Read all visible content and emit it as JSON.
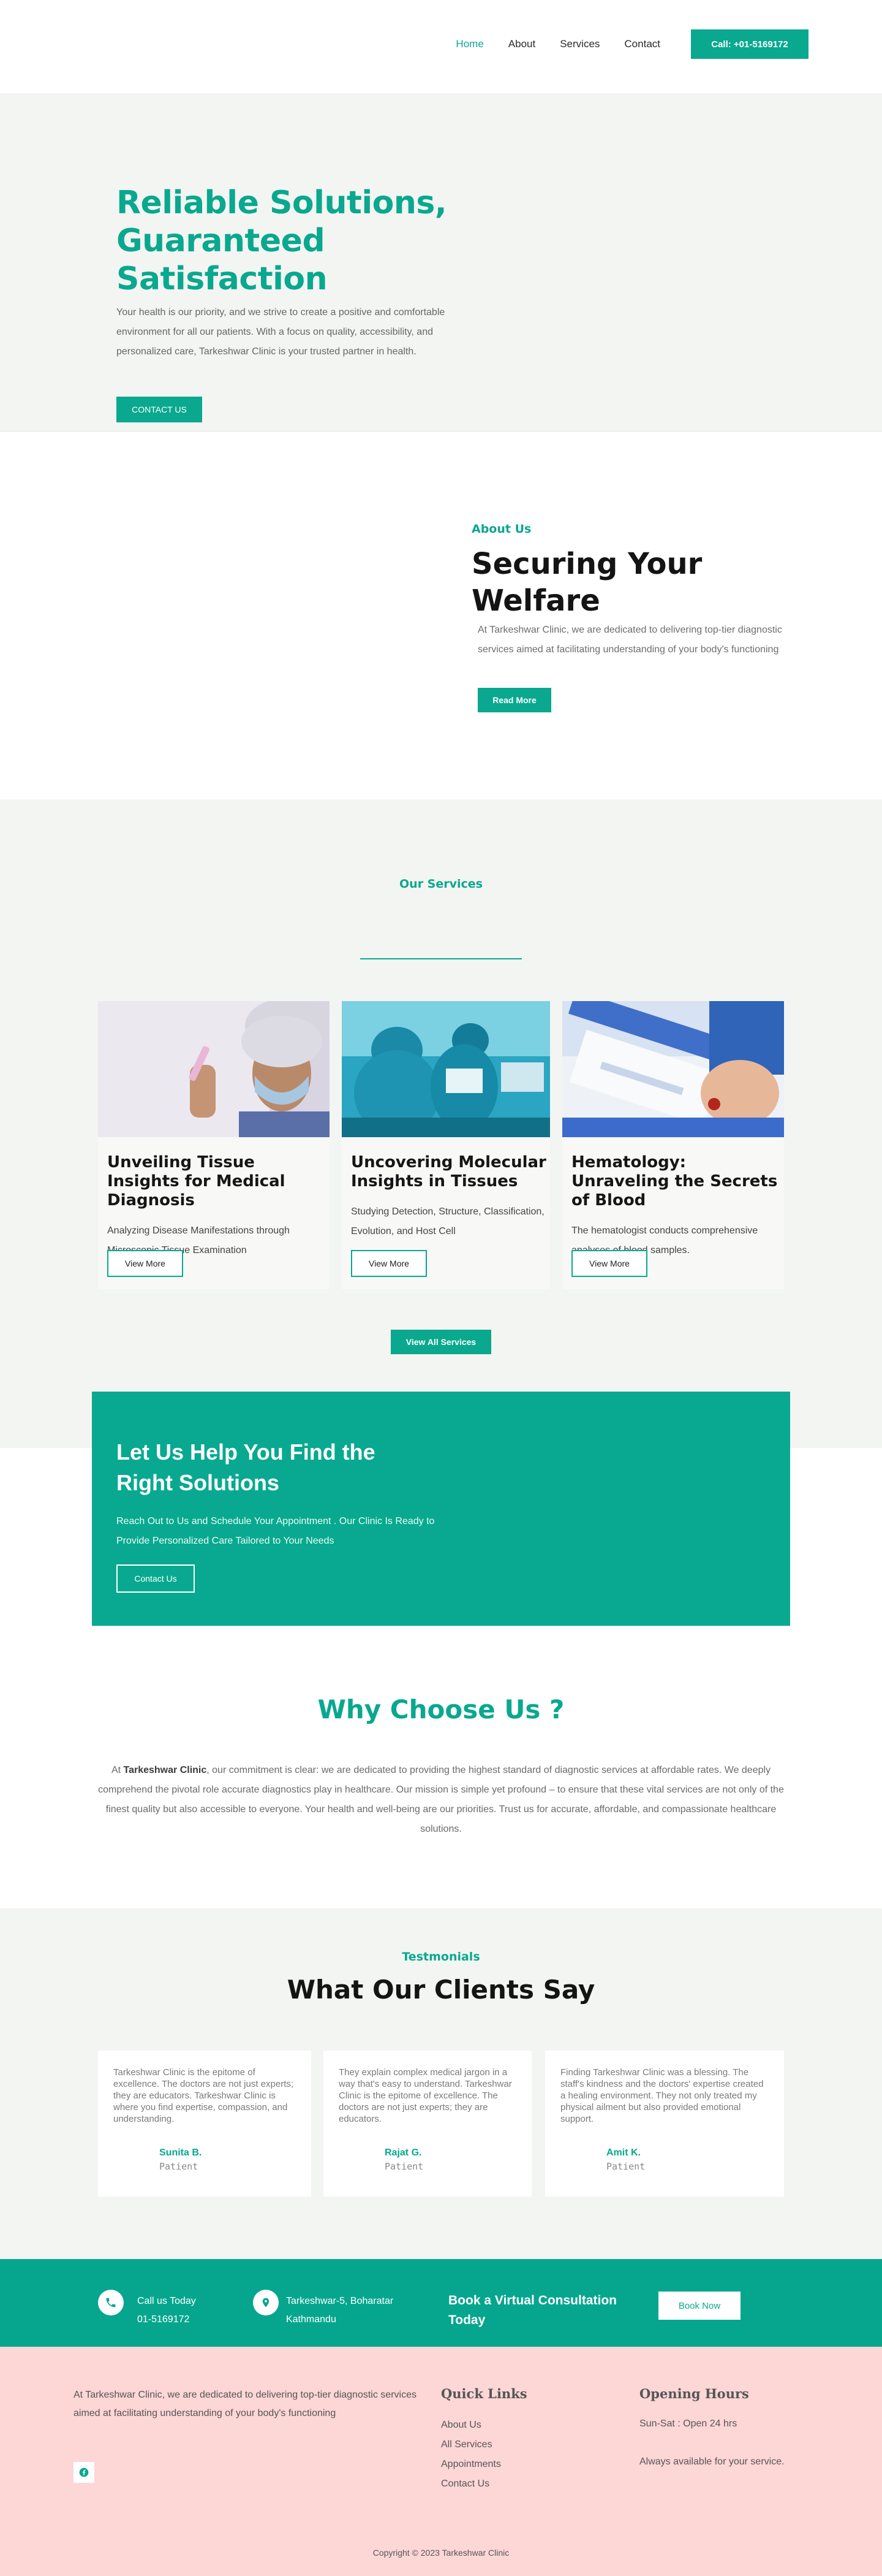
{
  "nav": {
    "items": [
      "Home",
      "About",
      "Services",
      "Contact"
    ],
    "call_label": "Call: +01-5169172"
  },
  "hero": {
    "title": "Reliable Solutions, Guaranteed Satisfaction",
    "text": "Your health is our priority, and we strive to create a positive and comfortable environment for all our patients. With a focus on quality, accessibility, and personalized care, Tarkeshwar Clinic is your trusted partner in health.",
    "button": "CONTACT US"
  },
  "about": {
    "eyebrow": "About Us",
    "title": "Securing Your Welfare",
    "text": "At Tarkeshwar Clinic, we are dedicated to delivering top-tier diagnostic services aimed at facilitating  understanding of your body's functioning",
    "button": "Read More"
  },
  "services": {
    "eyebrow": "Our Services",
    "cards": [
      {
        "title": "Unveiling Tissue Insights for Medical Diagnosis",
        "text": "Analyzing Disease Manifestations through Microscopic Tissue Examination",
        "button": "View More"
      },
      {
        "title": "Uncovering Molecular Insights in Tissues",
        "text": "Studying Detection, Structure, Classification, Evolution, and Host Cell",
        "button": "View More"
      },
      {
        "title": "Hematology: Unraveling the Secrets of Blood",
        "text": "The hematologist conducts comprehensive analyses of blood samples.",
        "button": "View More"
      }
    ],
    "all_button": "View All Services"
  },
  "cta": {
    "title": "Let Us Help You Find the Right Solutions",
    "text": "Reach Out to Us and Schedule Your Appointment . Our Clinic Is Ready to Provide Personalized Care Tailored to Your Needs",
    "button": "Contact Us"
  },
  "why": {
    "title": "Why Choose Us ?",
    "text_pre": "At ",
    "text_bold": "Tarkeshwar Clinic",
    "text_post": ", our commitment is clear: we are dedicated to providing the highest standard of diagnostic services at affordable rates. We deeply comprehend the pivotal role accurate diagnostics play in healthcare. Our mission is simple yet profound – to ensure that these vital services are not only of the finest quality but also accessible to everyone. Your health and well-being are our priorities. Trust us for accurate, affordable, and compassionate healthcare solutions."
  },
  "testimonials": {
    "eyebrow": "Testmonials",
    "title": "What Our Clients Say",
    "items": [
      {
        "text": "Tarkeshwar Clinic is the epitome of excellence. The doctors are not just experts; they are educators. Tarkeshwar Clinic is where you find expertise, compassion, and understanding.",
        "name": "Sunita B.",
        "role": "Patient"
      },
      {
        "text": "They explain complex medical jargon in a way that's easy to understand. Tarkeshwar Clinic is the epitome of excellence. The doctors are not just experts; they are educators.",
        "name": "Rajat G.",
        "role": "Patient"
      },
      {
        "text": "Finding Tarkeshwar Clinic was a blessing. The staff's kindness and the doctors' expertise created a healing environment. They not only treated my physical ailment but also provided emotional support.",
        "name": "Amit K.",
        "role": "Patient"
      }
    ]
  },
  "contact_strip": {
    "call_title": "Call us Today",
    "call_number": "01-5169172",
    "address_line1": "Tarkeshwar-5, Boharatar",
    "address_line2": "Kathmandu",
    "virtual": "Book a Virtual Consultation Today",
    "book_button": "Book Now"
  },
  "footer": {
    "about": "At Tarkeshwar Clinic, we are dedicated to delivering top-tier diagnostic services aimed at facilitating  understanding of your body's functioning",
    "quick_links_title": "Quick Links",
    "quick_links": [
      "About Us",
      "All Services",
      "Appointments",
      "Contact Us"
    ],
    "hours_title": "Opening Hours",
    "hours_line1": "Sun-Sat : Open 24 hrs",
    "hours_line2": "Always available for your service.",
    "copyright": "Copyright © 2023 Tarkeshwar Clinic"
  },
  "colors": {
    "accent": "#09a88f",
    "footer_bg": "#fdd6d6",
    "section_bg": "#f3f5f2"
  }
}
